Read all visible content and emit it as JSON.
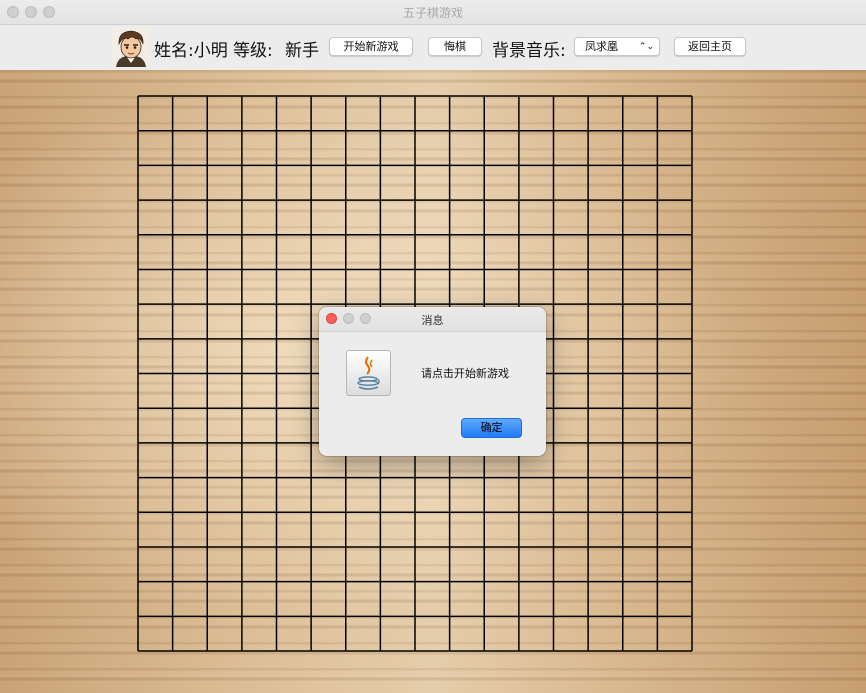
{
  "window": {
    "title": "五子棋游戏"
  },
  "toolbar": {
    "name_label": "姓名:小明",
    "level_label": "等级:",
    "level_value": "新手",
    "new_game_label": "开始新游戏",
    "undo_label": "悔棋",
    "music_label": "背景音乐:",
    "music_selected": "凤求凰",
    "back_home_label": "返回主页"
  },
  "board": {
    "lines": 17
  },
  "dialog": {
    "title": "消息",
    "message": "请点击开始新游戏",
    "ok_label": "确定"
  },
  "colors": {
    "accent": "#1f7cf5",
    "close_red": "#fe5f57",
    "grid": "#000000"
  },
  "icons": {
    "avatar": "player-avatar-icon",
    "dialog": "java-coffee-icon",
    "select": "chevron-updown-icon"
  }
}
